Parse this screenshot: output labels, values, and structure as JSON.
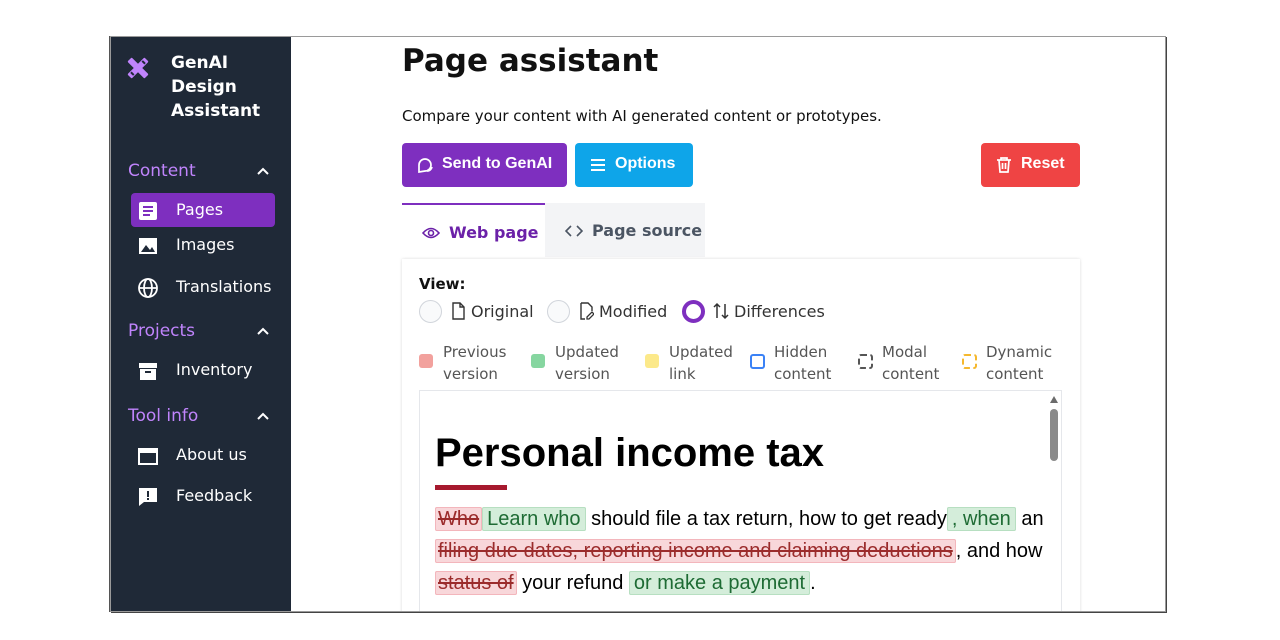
{
  "sidebar": {
    "brand": "GenAI\nDesign\nAssistant",
    "sections": [
      {
        "title": "Content",
        "items": [
          {
            "label": "Pages",
            "icon": "document-icon",
            "active": true
          },
          {
            "label": "Images",
            "icon": "image-icon"
          },
          {
            "label": "Translations",
            "icon": "globe-icon"
          }
        ]
      },
      {
        "title": "Projects",
        "items": [
          {
            "label": "Inventory",
            "icon": "archive-icon"
          }
        ]
      },
      {
        "title": "Tool info",
        "items": [
          {
            "label": "About us",
            "icon": "window-icon"
          },
          {
            "label": "Feedback",
            "icon": "feedback-icon"
          }
        ]
      }
    ]
  },
  "header": {
    "title": "Page assistant",
    "subtitle": "Compare your content with AI generated content or prototypes."
  },
  "toolbar": {
    "send_label": "Send to GenAI",
    "options_label": "Options",
    "reset_label": "Reset"
  },
  "tabs": [
    {
      "label": "Web page",
      "active": true
    },
    {
      "label": "Page source",
      "active": false
    }
  ],
  "view": {
    "label": "View:",
    "options": [
      {
        "label": "Original",
        "selected": false
      },
      {
        "label": "Modified",
        "selected": false
      },
      {
        "label": "Differences",
        "selected": true
      }
    ]
  },
  "legend": [
    {
      "label": "Previous\nversion",
      "color": "#f2a19d"
    },
    {
      "label": "Updated\nversion",
      "color": "#86d6a0"
    },
    {
      "label": "Updated\nlink",
      "color": "#fce98a"
    },
    {
      "label": "Hidden\ncontent",
      "color": "#3b82f6"
    },
    {
      "label": "Modal\ncontent",
      "color": "#555555"
    },
    {
      "label": "Dynamic\ncontent",
      "color": "#f5b82e"
    }
  ],
  "preview": {
    "title": "Personal income tax",
    "line1": {
      "del": "Who",
      "ins": "Learn who",
      "text": " should file a tax return, how to get ready",
      "ins2": ", when",
      "tail": " an"
    },
    "line2": {
      "del": "filing due dates, reporting income and claiming deductions",
      "text": ", and how"
    },
    "line3": {
      "del": "status of",
      "text": " your refund ",
      "ins": " or make a payment",
      "tail": "."
    }
  },
  "colors": {
    "sidebar_bg": "#1f2937",
    "accent": "#7e2fbf",
    "info": "#0ea5e9",
    "danger": "#ef4444",
    "section_title": "#c084fc"
  }
}
